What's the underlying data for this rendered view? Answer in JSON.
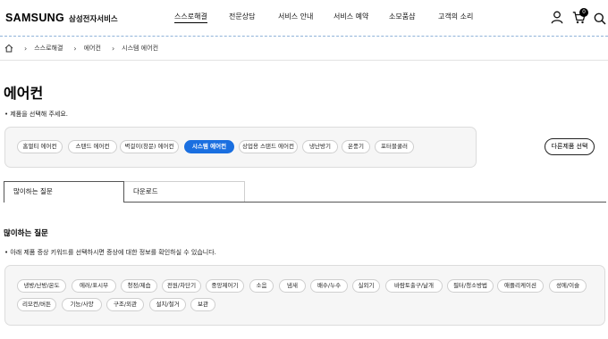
{
  "header": {
    "logo_mark": "SAMSUNG",
    "logo_text": "삼성전자서비스",
    "nav": [
      "스스로해결",
      "전문상담",
      "서비스 안내",
      "서비스 예약",
      "소모품샵",
      "고객의 소리"
    ],
    "cart_count": "0",
    "icons": [
      "user-icon",
      "cart-icon",
      "search-icon"
    ]
  },
  "breadcrumb": {
    "home_icon": "home-icon",
    "items": [
      "스스로해결",
      "에어컨",
      "시스템 에어컨"
    ]
  },
  "page": {
    "title": "에어컨",
    "hint": "• 제품을 선택해 주세요."
  },
  "categories": {
    "items": [
      "홈멀티 에어컨",
      "스탠드 에어컨",
      "벽걸이(창문) 에어컨",
      "시스템 에어컨",
      "상업용 스탠드 에어컨",
      "냉난방기",
      "온풍기",
      "포터블쿨러"
    ],
    "selected": "시스템 에어컨",
    "other_button": "다른제품 선택"
  },
  "tabs": {
    "items": [
      "많이하는 질문",
      "다운로드"
    ],
    "selected": "많이하는 질문"
  },
  "faq": {
    "title": "많이하는 질문",
    "hint": "• 아래 제품 증상 키워드를 선택하시면 증상에 대한 정보를 확인하실 수 있습니다.",
    "keywords": [
      "냉방/난방/온도",
      "에러/표시부",
      "청정/제습",
      "전원/차단기",
      "중앙제어기",
      "소음",
      "냄새",
      "배수/누수",
      "실외기",
      "바람토출구/날개",
      "필터/청소방법",
      "애플리케이션",
      "성에/이슬",
      "리모컨/버튼",
      "기능/사양",
      "구조/외관",
      "설치/철거",
      "보관"
    ]
  },
  "colors": {
    "accent": "#1a6fe0",
    "panel": "#f6f6f6",
    "divider": "#8fb3d9"
  }
}
